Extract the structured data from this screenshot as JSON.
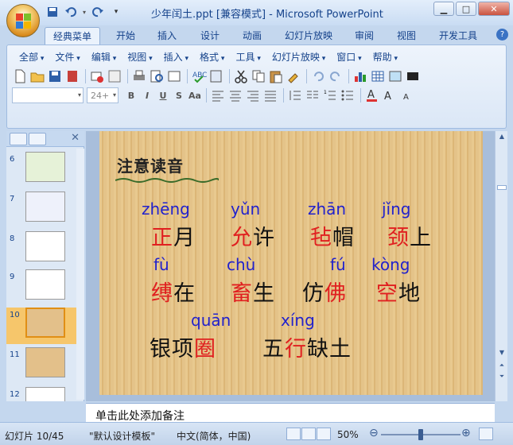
{
  "window": {
    "title": "少年闰土.ppt [兼容模式] - Microsoft PowerPoint"
  },
  "tabs": [
    "经典菜单",
    "开始",
    "插入",
    "设计",
    "动画",
    "幻灯片放映",
    "审阅",
    "视图",
    "开发工具"
  ],
  "menu": [
    "全部",
    "文件",
    "编辑",
    "视图",
    "插入",
    "格式",
    "工具",
    "幻灯片放映",
    "窗口",
    "帮助"
  ],
  "font": {
    "name": "",
    "size": "24+"
  },
  "format_buttons": [
    "B",
    "I",
    "U",
    "S",
    "Aa"
  ],
  "thumbnails": [
    {
      "num": "6"
    },
    {
      "num": "7"
    },
    {
      "num": "8"
    },
    {
      "num": "9"
    },
    {
      "num": "10"
    },
    {
      "num": "11"
    },
    {
      "num": "12"
    }
  ],
  "slide": {
    "heading": "注意读音",
    "row1": {
      "pinyin": [
        "zhēng",
        "yǔn",
        "zhān",
        "jǐng"
      ],
      "words": [
        {
          "red": "正",
          "black": "月"
        },
        {
          "red": "允",
          "black": "许"
        },
        {
          "red": "毡",
          "black": "帽"
        },
        {
          "red": "颈",
          "black": "上"
        }
      ]
    },
    "row2": {
      "pinyin": [
        "fù",
        "chù",
        "fú",
        "kòng"
      ],
      "words": [
        {
          "red": "缚",
          "black": "在",
          "order": "rb"
        },
        {
          "red": "畜",
          "black": "生",
          "order": "rb"
        },
        {
          "red": "佛",
          "black": "仿",
          "order": "br"
        },
        {
          "red": "空",
          "black": "地",
          "order": "rb"
        }
      ]
    },
    "row3": {
      "pinyin": [
        "quān",
        "xíng"
      ],
      "words": [
        {
          "pre": "银项",
          "red": "圈",
          "post": ""
        },
        {
          "pre": "五",
          "red": "行",
          "post": "缺土"
        }
      ]
    }
  },
  "notes": {
    "placeholder": "单击此处添加备注"
  },
  "status": {
    "slide_count": "幻灯片 10/45",
    "template": "\"默认设计模板\"",
    "language": "中文(简体，中国)",
    "zoom": "50%"
  },
  "colors": {
    "pinyin": "#2222cc",
    "highlight": "#e02020",
    "ribbon": "#dbe7f6"
  }
}
